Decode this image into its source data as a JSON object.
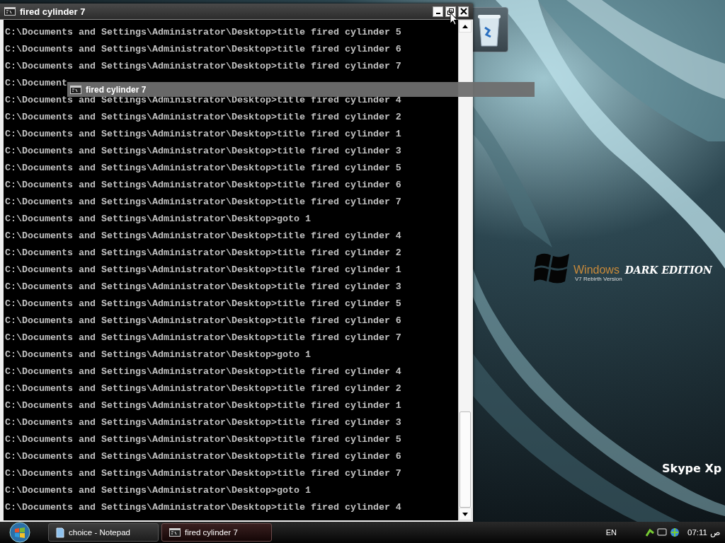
{
  "window": {
    "title": "fired cylinder 7",
    "lines": [
      "C:\\Documents and Settings\\Administrator\\Desktop>title fired cylinder 5",
      "C:\\Documents and Settings\\Administrator\\Desktop>title fired cylinder 6",
      "C:\\Documents and Settings\\Administrator\\Desktop>title fired cylinder 7",
      "C:\\Document",
      "C:\\Documents and Settings\\Administrator\\Desktop>title fired cylinder 4",
      "C:\\Documents and Settings\\Administrator\\Desktop>title fired cylinder 2",
      "C:\\Documents and Settings\\Administrator\\Desktop>title fired cylinder 1",
      "C:\\Documents and Settings\\Administrator\\Desktop>title fired cylinder 3",
      "C:\\Documents and Settings\\Administrator\\Desktop>title fired cylinder 5",
      "C:\\Documents and Settings\\Administrator\\Desktop>title fired cylinder 6",
      "C:\\Documents and Settings\\Administrator\\Desktop>title fired cylinder 7",
      "C:\\Documents and Settings\\Administrator\\Desktop>goto 1",
      "C:\\Documents and Settings\\Administrator\\Desktop>title fired cylinder 4",
      "C:\\Documents and Settings\\Administrator\\Desktop>title fired cylinder 2",
      "C:\\Documents and Settings\\Administrator\\Desktop>title fired cylinder 1",
      "C:\\Documents and Settings\\Administrator\\Desktop>title fired cylinder 3",
      "C:\\Documents and Settings\\Administrator\\Desktop>title fired cylinder 5",
      "C:\\Documents and Settings\\Administrator\\Desktop>title fired cylinder 6",
      "C:\\Documents and Settings\\Administrator\\Desktop>title fired cylinder 7",
      "C:\\Documents and Settings\\Administrator\\Desktop>goto 1",
      "C:\\Documents and Settings\\Administrator\\Desktop>title fired cylinder 4",
      "C:\\Documents and Settings\\Administrator\\Desktop>title fired cylinder 2",
      "C:\\Documents and Settings\\Administrator\\Desktop>title fired cylinder 1",
      "C:\\Documents and Settings\\Administrator\\Desktop>title fired cylinder 3",
      "C:\\Documents and Settings\\Administrator\\Desktop>title fired cylinder 5",
      "C:\\Documents and Settings\\Administrator\\Desktop>title fired cylinder 6",
      "C:\\Documents and Settings\\Administrator\\Desktop>title fired cylinder 7",
      "C:\\Documents and Settings\\Administrator\\Desktop>goto 1",
      "C:\\Documents and Settings\\Administrator\\Desktop>title fired cylinder 4"
    ]
  },
  "drag_ghost": {
    "title": "fired cylinder 7"
  },
  "desktop": {
    "logo_word": "Windows",
    "logo_subtitle": "V7 Rebirth Version",
    "logo_edition": "DARK EDITION",
    "caption": "Skype Xp"
  },
  "taskbar": {
    "tasks": [
      {
        "kind": "notepad",
        "label": "choice - Notepad",
        "selected": false
      },
      {
        "kind": "console",
        "label": "fired cylinder 7",
        "selected": true
      }
    ],
    "language": "EN",
    "clock": {
      "time": "07:11",
      "period": "ص"
    }
  }
}
